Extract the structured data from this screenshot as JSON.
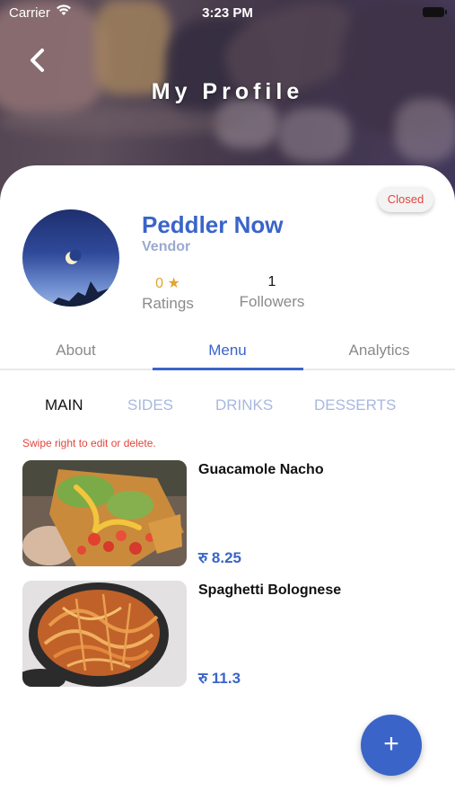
{
  "status_bar": {
    "carrier": "Carrier",
    "time": "3:23 PM"
  },
  "header": {
    "title": "My Profile",
    "back_icon": "chevron-left-icon"
  },
  "profile": {
    "status_badge": "Closed",
    "name": "Peddler Now",
    "role": "Vendor",
    "ratings_value": "0 ★",
    "ratings_label": "Ratings",
    "followers_value": "1",
    "followers_label": "Followers"
  },
  "tabs": [
    {
      "label": "About",
      "active": false
    },
    {
      "label": "Menu",
      "active": true
    },
    {
      "label": "Analytics",
      "active": false
    }
  ],
  "categories": [
    {
      "label": "MAIN",
      "active": true
    },
    {
      "label": "SIDES",
      "active": false
    },
    {
      "label": "DRINKS",
      "active": false
    },
    {
      "label": "DESSERTS",
      "active": false
    }
  ],
  "hint": "Swipe right to edit or delete.",
  "menu_items": [
    {
      "name": "Guacamole Nacho",
      "price": "रु 8.25"
    },
    {
      "name": "Spaghetti Bolognese",
      "price": "रु 11.3"
    }
  ],
  "fab_label": "+",
  "colors": {
    "accent": "#3a64c8",
    "closed": "#e2453d",
    "rating": "#e2a52e"
  }
}
